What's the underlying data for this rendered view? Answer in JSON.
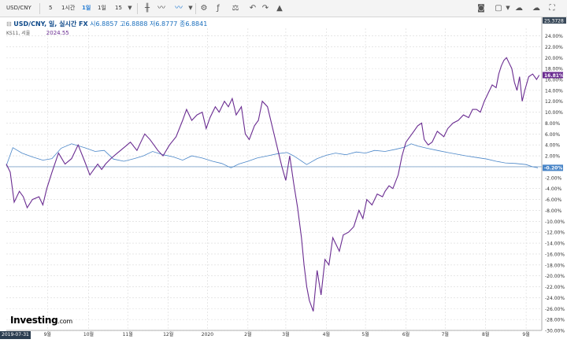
{
  "toolbar": {
    "symbol": "USD/CNY",
    "intervals": [
      "5",
      "1시간",
      "1일",
      "1일",
      "15"
    ],
    "active_index": 2
  },
  "legend": {
    "symbol": "USD/CNY, 일, 실시간 FX",
    "open_label": "시",
    "open": "6.8857",
    "high_label": "고",
    "high": "6.8888",
    "low_label": "저",
    "low": "6.8777",
    "close_label": "종",
    "close": "6.8841",
    "compare_name": "KS11, 서울",
    "compare_value": "2024.55"
  },
  "brand": {
    "name": "Investing",
    "suffix": ".com"
  },
  "colors": {
    "purple": "#6a2c91",
    "blue": "#4a86c8",
    "zero_line": "#7fa3c8",
    "badge_top": "#3a4a5a"
  },
  "chart_data": {
    "type": "line",
    "title": "",
    "xlabel": "",
    "ylabel": "",
    "ylim": [
      -30,
      25.3728
    ],
    "y_ticks": [
      "24.00%",
      "22.00%",
      "20.00%",
      "18.00%",
      "16.00%",
      "14.00%",
      "12.00%",
      "10.00%",
      "8.00%",
      "6.00%",
      "4.00%",
      "2.00%",
      "0.00%",
      "-2.00%",
      "-4.00%",
      "-6.00%",
      "-8.00%",
      "-10.00%",
      "-12.00%",
      "-14.00%",
      "-16.00%",
      "-18.00%",
      "-20.00%",
      "-22.00%",
      "-24.00%",
      "-26.00%",
      "-28.00%",
      "-30.00%"
    ],
    "y_tick_values": [
      24,
      22,
      20,
      18,
      16,
      14,
      12,
      10,
      8,
      6,
      4,
      2,
      0,
      -2,
      -4,
      -6,
      -8,
      -10,
      -12,
      -14,
      -16,
      -18,
      -20,
      -22,
      -24,
      -26,
      -28,
      -30
    ],
    "top_badge": "25.3728",
    "x_start_label": "2019-07-31",
    "x_ticks": [
      "9월",
      "10월",
      "11월",
      "12월",
      "2020",
      "2월",
      "3월",
      "4월",
      "5월",
      "6월",
      "7월",
      "8월",
      "9월"
    ],
    "x_tick_values": [
      31.5,
      63,
      93,
      124,
      154,
      185,
      214,
      245,
      275,
      306,
      336,
      367,
      398
    ],
    "x_range": [
      0,
      410
    ],
    "series": [
      {
        "name": "",
        "color": "#4a86c8",
        "last_label": "-0.20%",
        "x": [
          0,
          5,
          12,
          20,
          28,
          35,
          42,
          50,
          60,
          68,
          75,
          82,
          90,
          98,
          105,
          112,
          120,
          128,
          135,
          142,
          150,
          158,
          165,
          172,
          178,
          185,
          192,
          200,
          208,
          215,
          220,
          225,
          230,
          238,
          245,
          252,
          260,
          268,
          275,
          282,
          290,
          298,
          305,
          310,
          315,
          322,
          330,
          338,
          345,
          352,
          360,
          368,
          375,
          382,
          390,
          398,
          403,
          407
        ],
        "y": [
          0.2,
          3.5,
          2.5,
          1.8,
          1.2,
          1.5,
          3.4,
          4.2,
          3.5,
          2.8,
          3.0,
          1.4,
          1.0,
          1.5,
          2.0,
          2.8,
          2.2,
          1.8,
          1.2,
          2.0,
          1.6,
          1.0,
          0.6,
          -0.2,
          0.5,
          1.0,
          1.6,
          2.0,
          2.4,
          2.6,
          2.0,
          1.2,
          0.4,
          1.5,
          2.1,
          2.5,
          2.2,
          2.7,
          2.5,
          3.0,
          2.8,
          3.2,
          3.6,
          4.2,
          3.8,
          3.4,
          3.0,
          2.6,
          2.3,
          2.0,
          1.7,
          1.4,
          1.0,
          0.7,
          0.6,
          0.4,
          0.0,
          -0.2
        ]
      },
      {
        "name": "",
        "color": "#6a2c91",
        "last_label": "16.81%",
        "x": [
          0,
          3,
          6,
          10,
          13,
          16,
          20,
          25,
          28,
          31,
          35,
          40,
          45,
          50,
          55,
          60,
          64,
          67,
          70,
          73,
          76,
          80,
          85,
          90,
          95,
          100,
          103,
          106,
          110,
          113,
          116,
          120,
          125,
          130,
          135,
          138,
          142,
          146,
          150,
          153,
          156,
          160,
          163,
          167,
          170,
          173,
          176,
          180,
          183,
          186,
          190,
          193,
          196,
          200,
          204,
          208,
          211,
          214,
          217,
          220,
          223,
          226,
          228,
          230,
          232,
          235,
          238,
          241,
          244,
          247,
          250,
          255,
          258,
          262,
          266,
          270,
          273,
          276,
          280,
          284,
          288,
          290,
          293,
          296,
          300,
          303,
          306,
          309,
          312,
          315,
          318,
          320,
          323,
          326,
          330,
          335,
          338,
          342,
          346,
          350,
          354,
          357,
          360,
          363,
          366,
          369,
          372,
          375,
          377,
          379,
          381,
          383,
          385,
          387,
          389,
          391,
          393,
          395,
          397,
          400,
          403,
          406,
          408
        ],
        "y": [
          0.5,
          -1.0,
          -6.5,
          -4.5,
          -5.5,
          -7.5,
          -6.0,
          -5.5,
          -7.0,
          -4.0,
          -1.0,
          2.5,
          0.5,
          1.5,
          4.0,
          1.0,
          -1.5,
          -0.5,
          0.5,
          -0.5,
          0.5,
          1.5,
          2.5,
          3.5,
          4.5,
          3.0,
          4.5,
          6.0,
          5.0,
          4.0,
          3.0,
          2.0,
          4.0,
          5.5,
          8.5,
          10.5,
          8.5,
          9.5,
          10.0,
          7.0,
          9.0,
          11.0,
          10.0,
          12.0,
          11.0,
          12.5,
          9.5,
          11.0,
          6.0,
          5.0,
          7.5,
          8.5,
          12.0,
          11.0,
          7.0,
          3.0,
          0.0,
          -2.5,
          2.0,
          -3.0,
          -7.5,
          -13.0,
          -18.0,
          -22.0,
          -24.5,
          -26.5,
          -19.0,
          -23.5,
          -17.0,
          -18.0,
          -13.0,
          -15.5,
          -12.5,
          -12.0,
          -11.0,
          -8.0,
          -9.5,
          -6.0,
          -7.0,
          -5.0,
          -5.5,
          -4.5,
          -3.5,
          -4.0,
          -1.5,
          2.0,
          4.5,
          5.5,
          6.5,
          7.5,
          8.0,
          5.0,
          4.0,
          4.5,
          6.5,
          5.5,
          7.0,
          8.0,
          8.5,
          9.5,
          9.0,
          10.5,
          10.5,
          10.0,
          12.0,
          13.5,
          15.0,
          14.5,
          17.0,
          18.5,
          19.5,
          20.0,
          19.0,
          18.0,
          15.5,
          14.0,
          16.5,
          12.0,
          14.0,
          16.5,
          17.0,
          16.0,
          16.8
        ]
      }
    ]
  }
}
